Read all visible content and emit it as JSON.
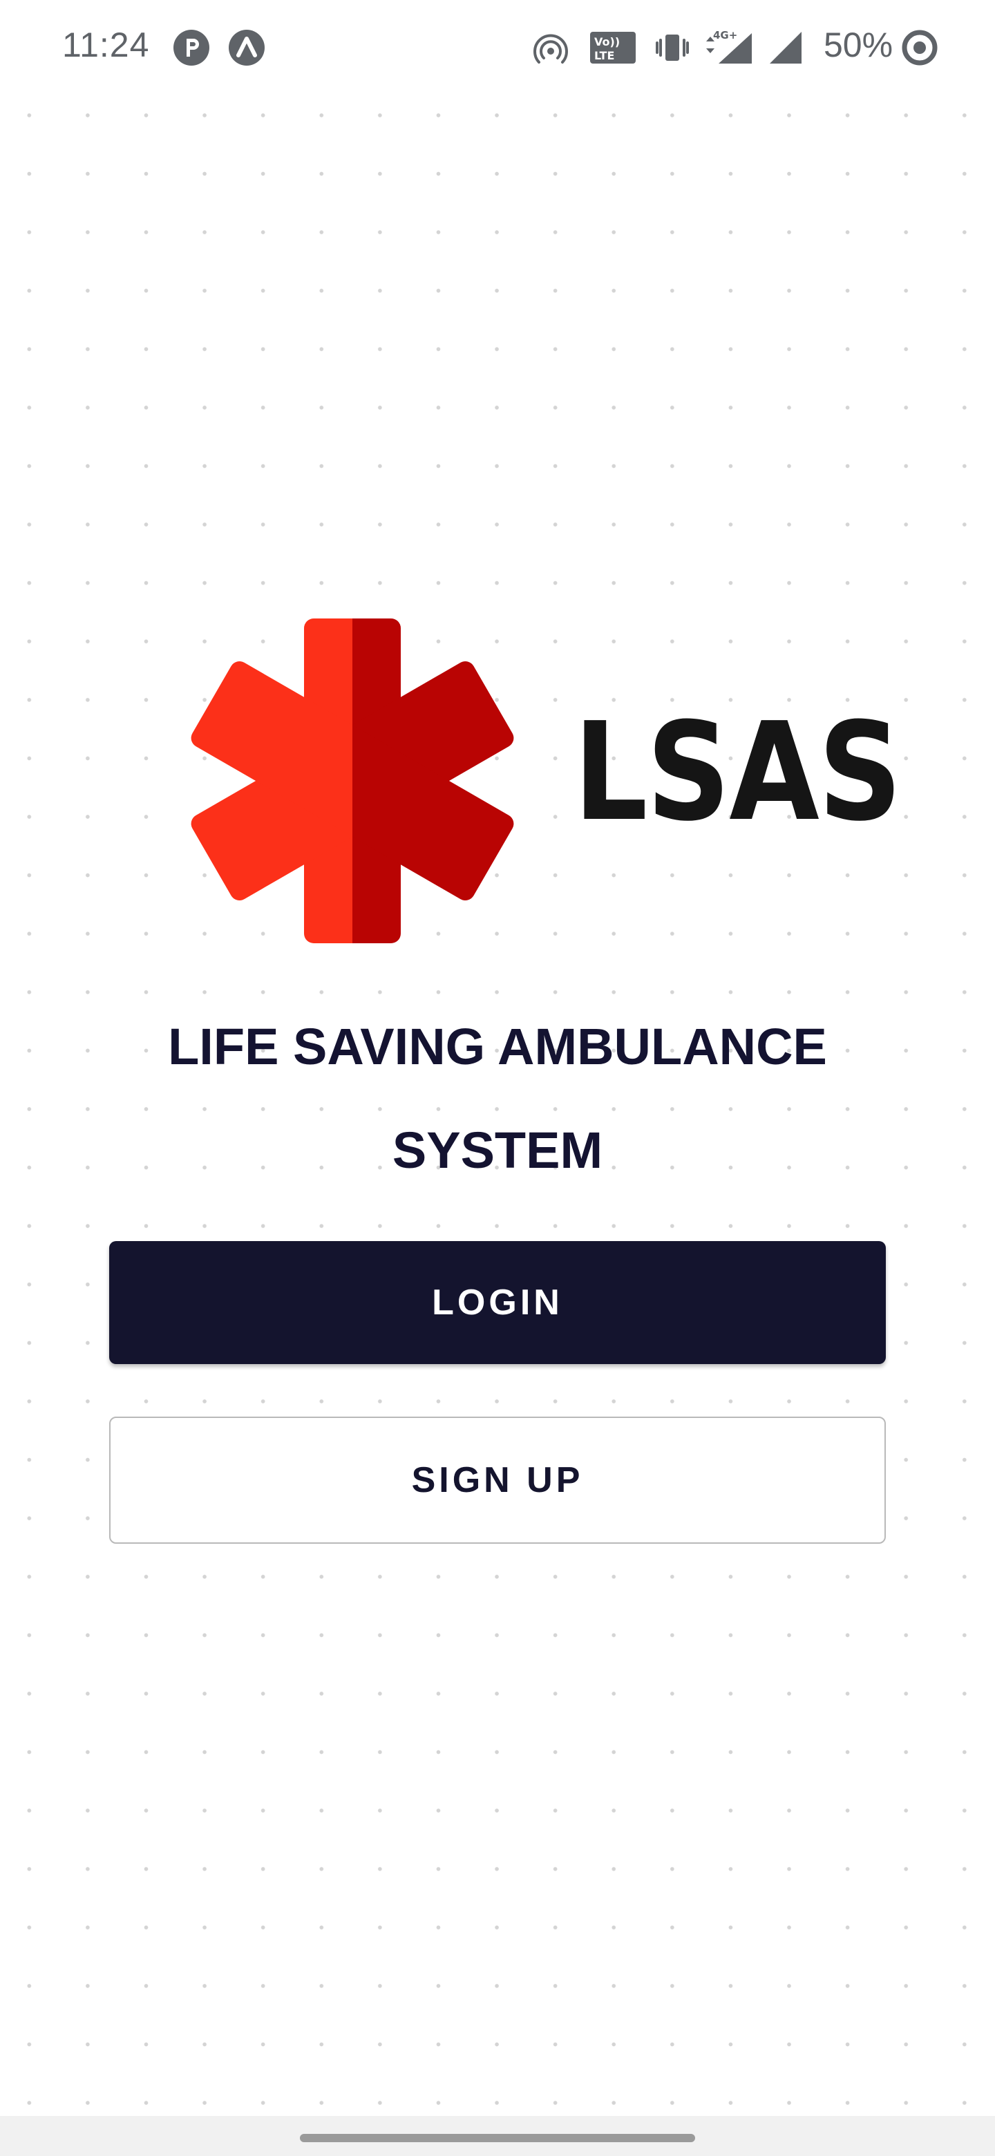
{
  "status_bar": {
    "time": "11:24",
    "battery": "50%",
    "network_label": "4G+",
    "volte_label_top": "Vo))",
    "volte_label_bottom": "LTE",
    "icons": [
      "pocket-casts-icon",
      "arc-browser-icon",
      "hotspot-icon",
      "volte-icon",
      "vibrate-icon",
      "signal-4g-icon",
      "signal-icon",
      "battery-saver-icon"
    ]
  },
  "logo": {
    "brand": "LSAS",
    "symbol": "star-of-life-icon",
    "colors": {
      "left_half": "#fc3019",
      "right_half": "#b90403"
    }
  },
  "title": {
    "line1": "LIFE SAVING AMBULANCE",
    "line2": "SYSTEM"
  },
  "actions": {
    "login_label": "LOGIN",
    "signup_label": "SIGN UP"
  },
  "colors": {
    "primary": "#14142e",
    "background": "#ffffff",
    "outline": "#b9b9b9"
  }
}
